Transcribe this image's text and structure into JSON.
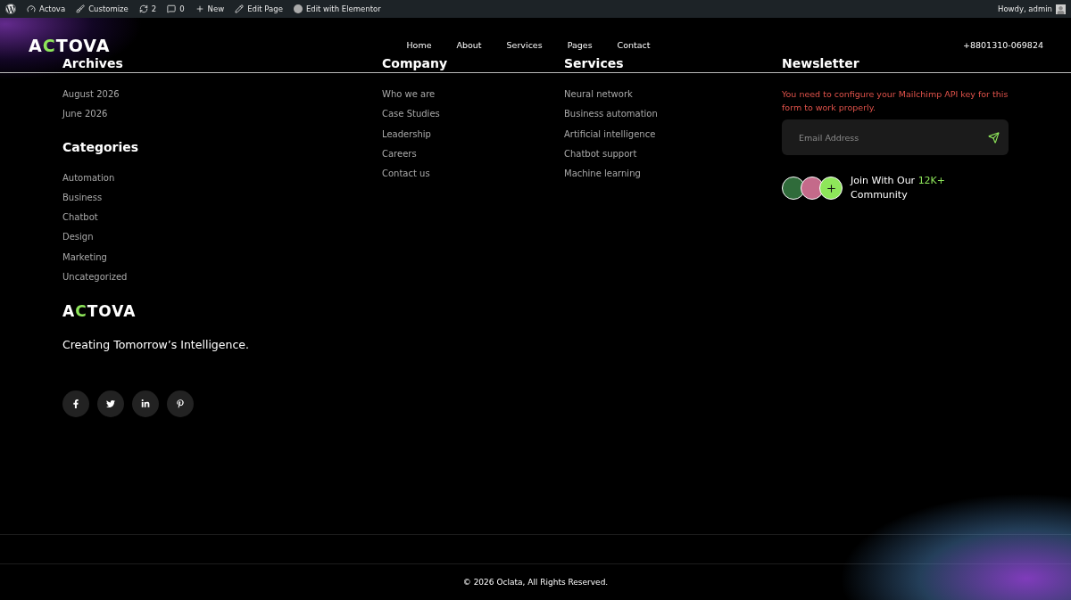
{
  "admin_bar": {
    "items": [
      {
        "kind": "wp"
      },
      {
        "kind": "site",
        "label": "Actova"
      },
      {
        "kind": "customize",
        "label": "Customize"
      },
      {
        "kind": "updates",
        "label": "2"
      },
      {
        "kind": "comments",
        "label": "0"
      },
      {
        "kind": "new",
        "label": "New"
      },
      {
        "kind": "edit",
        "label": "Edit Page"
      },
      {
        "kind": "elementor",
        "label": "Edit with Elementor"
      }
    ],
    "greeting": "Howdy, admin"
  },
  "header": {
    "logo": "ACTOVA",
    "nav": [
      {
        "label": "Home"
      },
      {
        "label": "About"
      },
      {
        "label": "Services"
      },
      {
        "label": "Pages"
      },
      {
        "label": "Contact"
      }
    ],
    "phone": "+8801310-069824"
  },
  "archives": {
    "title": "Archives",
    "items": [
      "August 2026",
      "June 2026"
    ]
  },
  "categories": {
    "title": "Categories",
    "items": [
      "Automation",
      "Business",
      "Chatbot",
      "Design",
      "Marketing",
      "Uncategorized"
    ]
  },
  "brand": {
    "logo": "ACTOVA",
    "tagline": "Creating Tomorrow’s Intelligence.",
    "social": [
      {
        "kind": "facebook"
      },
      {
        "kind": "twitter"
      },
      {
        "kind": "linkedin"
      },
      {
        "kind": "pinterest"
      }
    ]
  },
  "company": {
    "title": "Company",
    "items": [
      "Who we are",
      "Case Studies",
      "Leadership",
      "Careers",
      "Contact us"
    ]
  },
  "services": {
    "title": "Services",
    "items": [
      "Neural network",
      "Business automation",
      "Artificial intelligence",
      "Chatbot support",
      "Machine learning"
    ]
  },
  "newsletter": {
    "title": "Newsletter",
    "error": "You need to configure your Mailchimp API key for this form to work properly.",
    "placeholder": "Email Address",
    "community_before": "Join With Our",
    "community_count": "12K+",
    "community_after": "Community"
  },
  "copyright": "© 2026 Oclata, All Rights Reserved."
}
